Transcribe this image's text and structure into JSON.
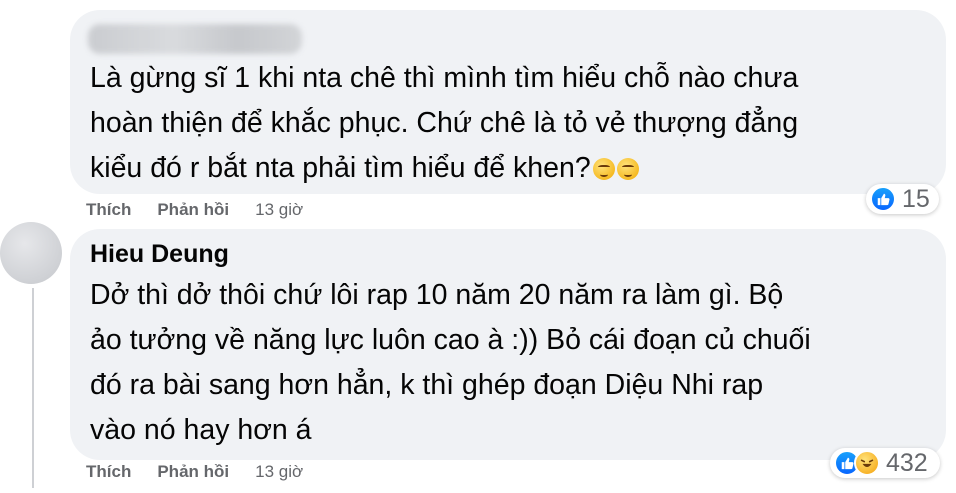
{
  "comments": [
    {
      "author": "",
      "text": "Là gừng sĩ 1 khi nta chê thì mình tìm hiểu chỗ nào chưa\nhoàn thiện để khắc phục. Chứ chê là tỏ vẻ thượng đẳng\nkiểu đó r bắt nta phải tìm hiểu để khen?",
      "reaction_count": "15",
      "reaction_icons": [
        "like-icon"
      ],
      "actions": {
        "like": "Thích",
        "reply": "Phản hồi",
        "time": "13 giờ"
      }
    },
    {
      "author": "Hieu Deung",
      "text": "Dở thì dở thôi chứ lôi rap 10 năm 20 năm ra làm gì. Bộ\nảo tưởng về năng lực luôn cao à :)) Bỏ cái đoạn củ chuối\nđó ra bài sang hơn hẳn, k thì ghép đoạn Diệu Nhi rap\nvào nó hay hơn á",
      "reaction_count": "432",
      "reaction_icons": [
        "like-icon",
        "haha-icon"
      ],
      "actions": {
        "like": "Thích",
        "reply": "Phản hồi",
        "time": "13 giờ"
      }
    }
  ],
  "colors": {
    "bubble": "#f0f2f5",
    "secondary_text": "#65676b",
    "like_blue": "#0866ff"
  }
}
